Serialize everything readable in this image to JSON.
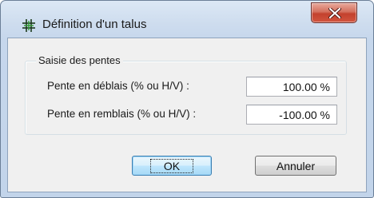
{
  "window": {
    "title": "Définition d'un talus",
    "icon": "grid-hash-icon",
    "close_icon": "close-x-icon"
  },
  "group": {
    "label": "Saisie des pentes"
  },
  "rows": [
    {
      "label": "Pente en déblais (% ou H/V) :",
      "value": "100.00 %"
    },
    {
      "label": "Pente en remblais (% ou H/V) :",
      "value": "-100.00 %"
    }
  ],
  "buttons": {
    "ok_label": "OK",
    "cancel_label": "Annuler"
  },
  "colors": {
    "title_bar": "#c6d7ec",
    "close_button": "#c3412d",
    "dialog_bg": "#f0f0f0",
    "default_button_border": "#3c7fb1"
  }
}
